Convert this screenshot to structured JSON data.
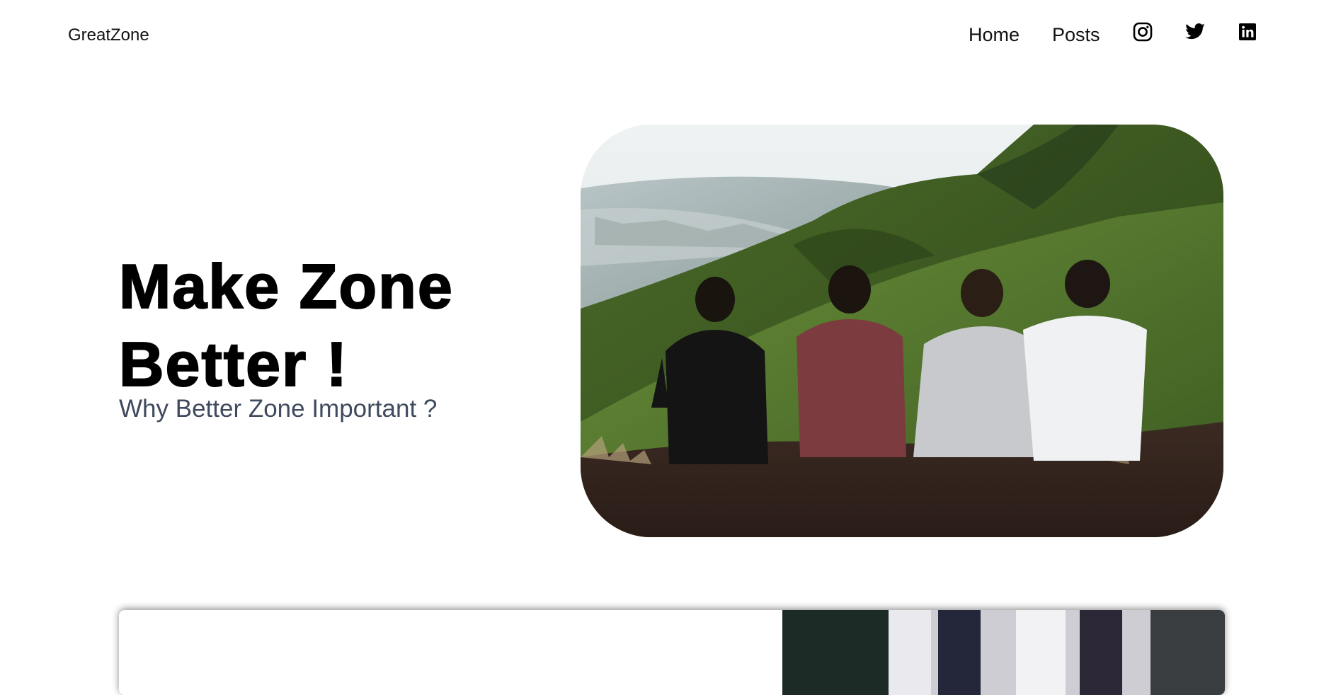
{
  "nav": {
    "brand": "GreatZone",
    "links": [
      {
        "label": "Home"
      },
      {
        "label": "Posts"
      }
    ],
    "social_icons": [
      "instagram-icon",
      "twitter-icon",
      "linkedin-icon"
    ]
  },
  "hero": {
    "title_line1": "Make Zone",
    "title_line2": "Better !",
    "subtitle": "Why Better Zone Important ?",
    "image_alt": "four men sitting on a green mountain ridge"
  },
  "colors": {
    "text": "#111111",
    "subtitle": "#3f4a5e",
    "background": "#ffffff"
  }
}
